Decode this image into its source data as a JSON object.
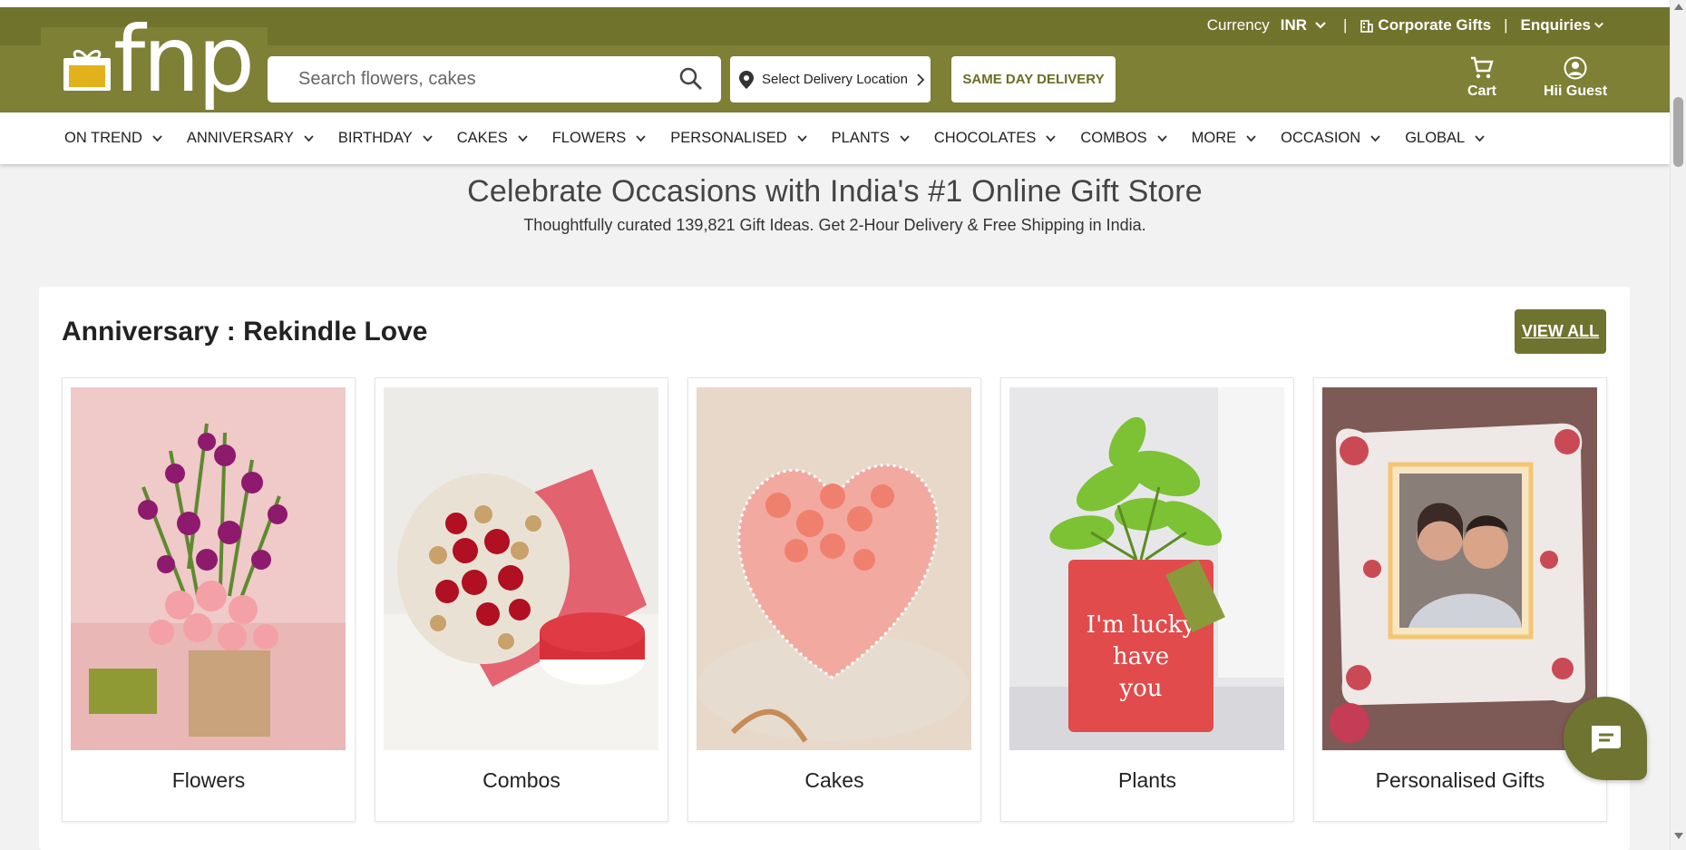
{
  "header": {
    "currency_label": "Currency",
    "currency_value": "INR",
    "corporate_gifts": "Corporate Gifts",
    "enquiries": "Enquiries",
    "separator": "|",
    "logo_text": "fnp",
    "search_placeholder": "Search flowers, cakes",
    "delivery_location": "Select Delivery Location",
    "same_day": "SAME DAY DELIVERY",
    "cart_label": "Cart",
    "guest_label": "Hii Guest",
    "brand_color": "#7d8035"
  },
  "nav": {
    "items": [
      {
        "label": "ON TREND"
      },
      {
        "label": "ANNIVERSARY"
      },
      {
        "label": "BIRTHDAY"
      },
      {
        "label": "CAKES"
      },
      {
        "label": "FLOWERS"
      },
      {
        "label": "PERSONALISED"
      },
      {
        "label": "PLANTS"
      },
      {
        "label": "CHOCOLATES"
      },
      {
        "label": "COMBOS"
      },
      {
        "label": "MORE"
      },
      {
        "label": "OCCASION"
      },
      {
        "label": "GLOBAL"
      }
    ]
  },
  "hero": {
    "title": "Celebrate Occasions with India's #1 Online Gift Store",
    "subtitle": "Thoughtfully curated 139,821 Gift Ideas. Get 2-Hour Delivery & Free Shipping in India."
  },
  "section": {
    "title": "Anniversary : Rekindle Love",
    "view_all": "VIEW ALL",
    "cards": [
      {
        "label": "Flowers"
      },
      {
        "label": "Combos"
      },
      {
        "label": "Cakes"
      },
      {
        "label": "Plants"
      },
      {
        "label": "Personalised Gifts"
      }
    ]
  }
}
